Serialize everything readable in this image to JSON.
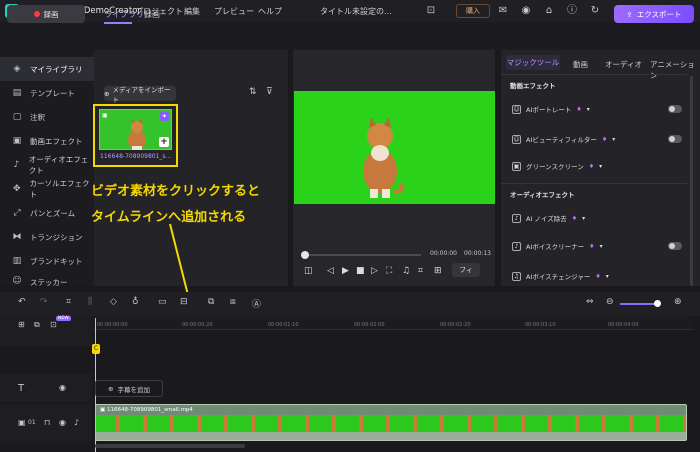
{
  "titlebar": {
    "app_title": "Wondershare DemoCreator",
    "menu": [
      "プロジェクト",
      "編集",
      "プレビュー",
      "ヘルプ"
    ],
    "doc_title": "タイトル未設定の...",
    "buy_label": "購入"
  },
  "topbar": {
    "record_label": "録画",
    "export_label": "エクスポート"
  },
  "leftnav": {
    "items": [
      {
        "icon": "layers-icon",
        "glyph": "◈",
        "label": "マイライブラリ"
      },
      {
        "icon": "template-icon",
        "glyph": "▤",
        "label": "テンプレート"
      },
      {
        "icon": "annotation-icon",
        "glyph": "▢",
        "label": "注釈"
      },
      {
        "icon": "video-effect-icon",
        "glyph": "▣",
        "label": "動画エフェクト"
      },
      {
        "icon": "audio-effect-icon",
        "glyph": "♪",
        "label": "オーディオエフェクト"
      },
      {
        "icon": "cursor-effect-icon",
        "glyph": "✥",
        "label": "カーソルエフェクト"
      },
      {
        "icon": "pan-zoom-icon",
        "glyph": "⤢",
        "label": "パンとズーム"
      },
      {
        "icon": "transition-icon",
        "glyph": "⧓",
        "label": "トランジション"
      },
      {
        "icon": "brand-kit-icon",
        "glyph": "▥",
        "label": "ブランドキット"
      },
      {
        "icon": "sticker-icon",
        "glyph": "☺",
        "label": "ステッカー"
      }
    ]
  },
  "media": {
    "tabs": [
      "ライブラリ",
      "録画"
    ],
    "import_label": "メディアをインポート",
    "clip_name": "116648-708909801_s..."
  },
  "annotation": {
    "line1": "ビデオ素材をクリックすると",
    "line2": "タイムラインへ追加される"
  },
  "preview": {
    "time_current": "00:00:00",
    "time_total": "00:00:13",
    "fit_label": "フィ"
  },
  "rightpanel": {
    "tabs": [
      "マジックツール",
      "動画",
      "オーディオ",
      "アニメーション"
    ],
    "video_section": "動画エフェクト",
    "video_items": [
      "AIポートレート",
      "AIビューティフィルター",
      "グリーンスクリーン"
    ],
    "audio_section": "オーディオエフェクト",
    "audio_items": [
      "AI ノイズ除去",
      "AIボイスクリーナー",
      "AIボイスチェンジャー"
    ]
  },
  "timeline": {
    "ticks": [
      "00:00:00:00",
      "00:00:00:20",
      "00:00:01:10",
      "00:00:02:00",
      "00:00:02:20",
      "00:00:03:10",
      "00:00:04:00"
    ],
    "playhead_label": "C",
    "new_badge": "NEW",
    "add_subtitle_label": "字幕を追加",
    "track_number": "01",
    "clip_label": "116648-708909801_small.mp4"
  },
  "colors": {
    "accent": "#9b7bff",
    "annotation": "#f5d800",
    "greenscreen": "#2ad21a"
  }
}
